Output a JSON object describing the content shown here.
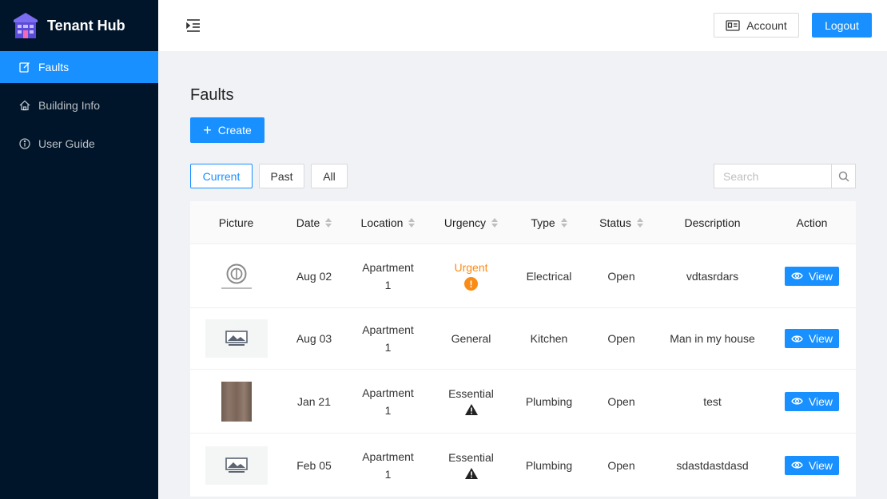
{
  "app": {
    "title": "Tenant Hub"
  },
  "sidebar": {
    "items": [
      {
        "label": "Faults",
        "icon": "edit-icon",
        "active": true
      },
      {
        "label": "Building Info",
        "icon": "home-icon",
        "active": false
      },
      {
        "label": "User Guide",
        "icon": "info-icon",
        "active": false
      }
    ]
  },
  "header": {
    "account_label": "Account",
    "logout_label": "Logout"
  },
  "page": {
    "title": "Faults",
    "create_label": "Create",
    "filters": [
      "Current",
      "Past",
      "All"
    ],
    "active_filter": "Current",
    "search": {
      "placeholder": "Search"
    }
  },
  "table": {
    "columns": [
      "Picture",
      "Date",
      "Location",
      "Urgency",
      "Type",
      "Status",
      "Description",
      "Action"
    ],
    "rows": [
      {
        "picture": "logo-thumbnail",
        "date": "Aug 02",
        "location_line1": "Apartment",
        "location_line2": "1",
        "urgency": "Urgent",
        "type": "Electrical",
        "status": "Open",
        "description": "vdtasrdars",
        "action": "View"
      },
      {
        "picture": "image-placeholder",
        "date": "Aug 03",
        "location_line1": "Apartment",
        "location_line2": "1",
        "urgency": "General",
        "type": "Kitchen",
        "status": "Open",
        "description": "Man in my house",
        "action": "View"
      },
      {
        "picture": "photo-thumbnail",
        "date": "Jan 21",
        "location_line1": "Apartment",
        "location_line2": "1",
        "urgency": "Essential",
        "type": "Plumbing",
        "status": "Open",
        "description": "test",
        "action": "View"
      },
      {
        "picture": "image-placeholder",
        "date": "Feb 05",
        "location_line1": "Apartment",
        "location_line2": "1",
        "urgency": "Essential",
        "type": "Plumbing",
        "status": "Open",
        "description": "sdastdastdasd",
        "action": "View"
      }
    ]
  },
  "colors": {
    "primary": "#1890ff",
    "sidebar": "#001529",
    "urgent": "#fa8c16"
  }
}
